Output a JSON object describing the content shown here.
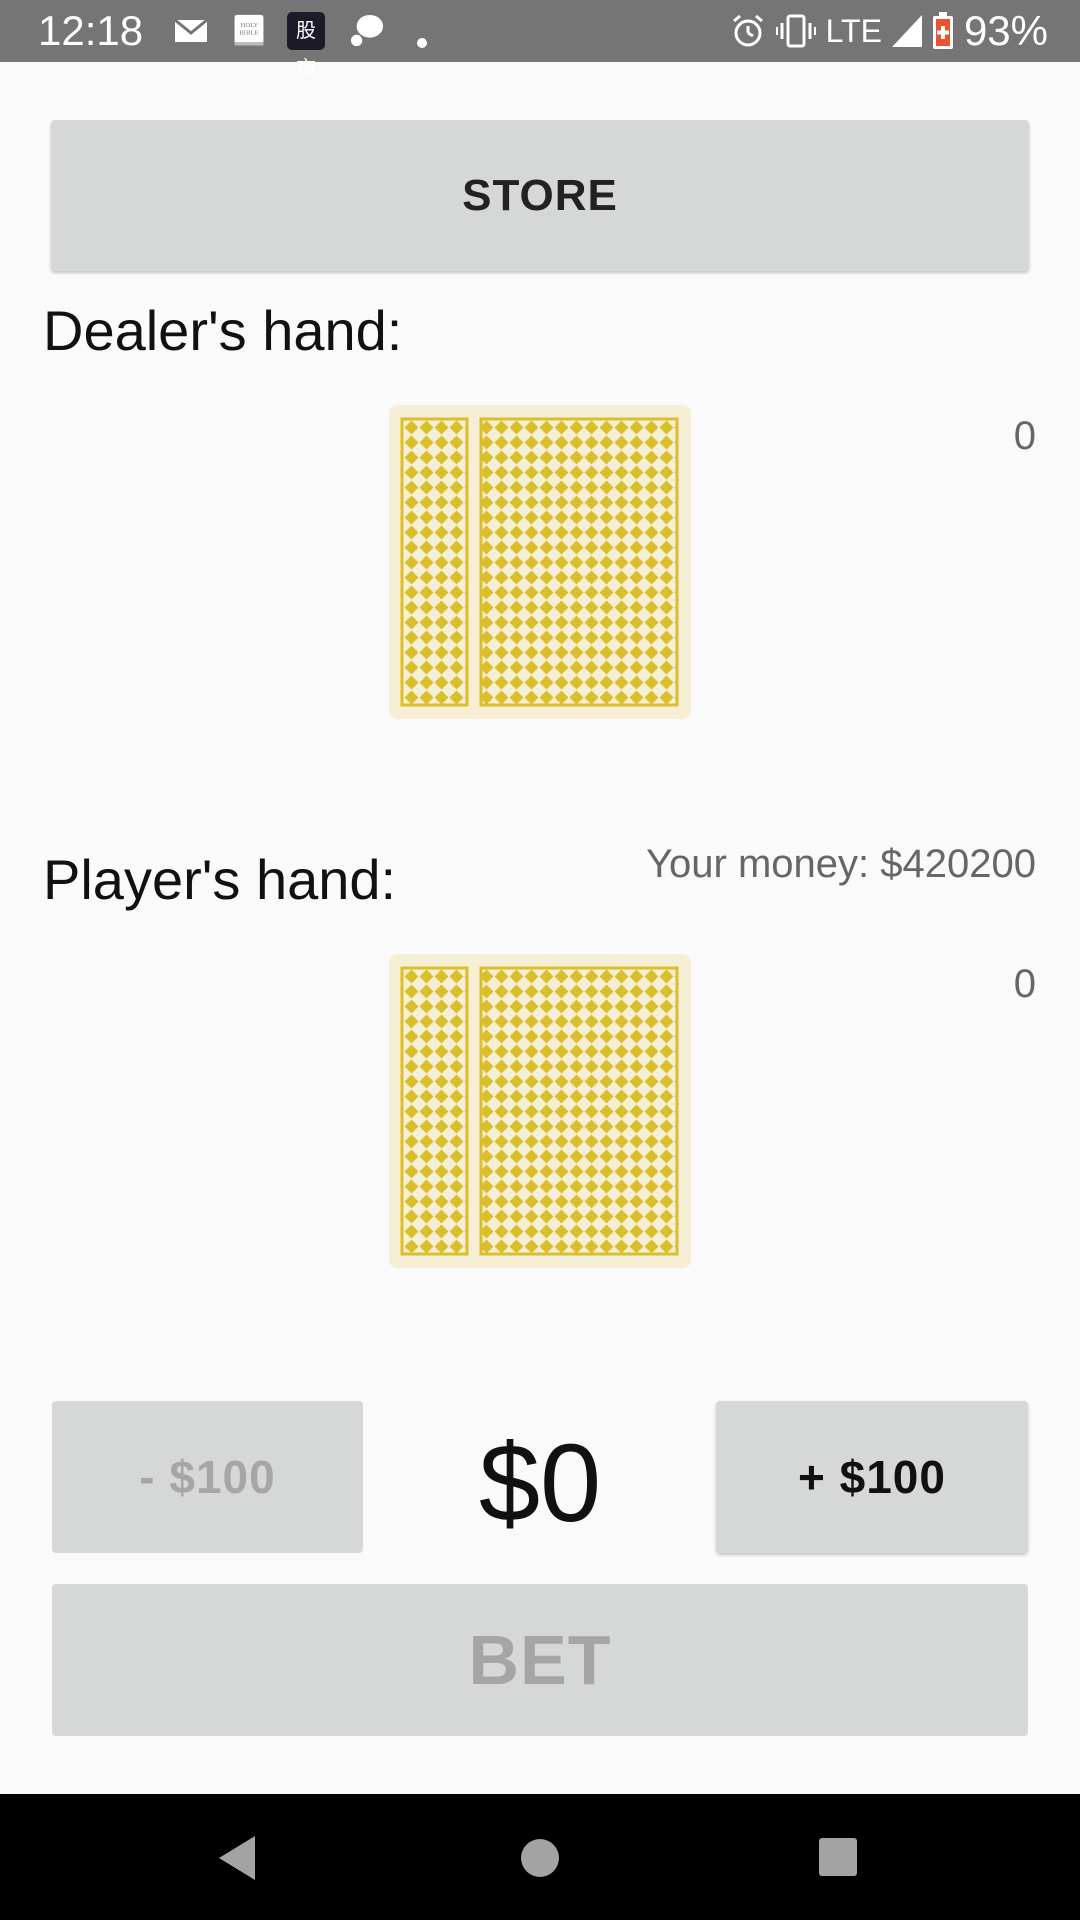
{
  "status_bar": {
    "time": "12:18",
    "network": "LTE",
    "battery": "93%",
    "icons": [
      "mail-icon",
      "bible-icon",
      "stocks-icon",
      "chat-icon",
      "dot-icon",
      "alarm-icon",
      "vibrate-icon",
      "signal-icon",
      "battery-icon"
    ],
    "stocks_label": "股市"
  },
  "store_button": {
    "label": "STORE"
  },
  "dealer": {
    "label": "Dealer's hand:",
    "score": "0"
  },
  "player": {
    "label": "Player's hand:",
    "score": "0",
    "money": "Your money: $420200"
  },
  "bet_controls": {
    "minus_label": "- $100",
    "plus_label": "+ $100",
    "amount": "$0",
    "bet_label": "BET"
  },
  "colors": {
    "card_yellow": "#d9bf2b",
    "card_background": "#f6efd6",
    "button_gray": "#d6d7d7",
    "status_bar": "#757575"
  },
  "nav_bar": {
    "icons": [
      "back-icon",
      "home-icon",
      "recents-icon"
    ]
  }
}
